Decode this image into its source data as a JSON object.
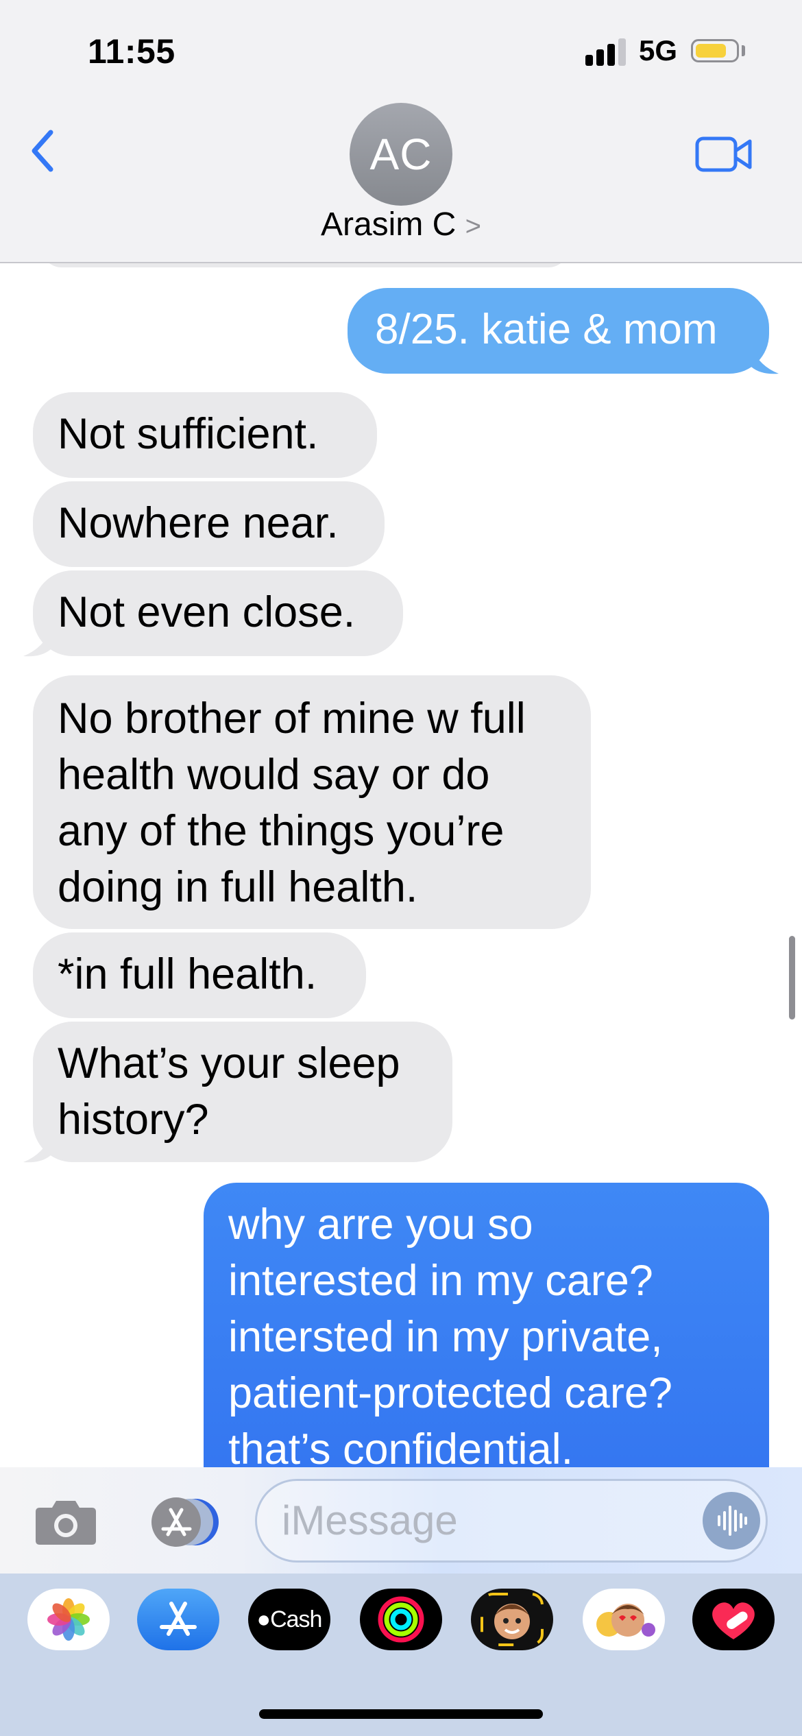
{
  "status_bar": {
    "time": "11:55",
    "network": "5G",
    "battery_level": 0.7,
    "signal_bars": 3
  },
  "header": {
    "avatar_initials": "AC",
    "contact_name": "Arasim C",
    "chevron": ">",
    "back_icon": "chevron-left-icon",
    "video_icon": "video-camera-icon"
  },
  "messages": [
    {
      "direction": "outgoing",
      "text": "8/25. katie & mom"
    },
    {
      "direction": "incoming",
      "text": "Not sufficient."
    },
    {
      "direction": "incoming",
      "text": "Nowhere near."
    },
    {
      "direction": "incoming",
      "text": "Not even close."
    },
    {
      "direction": "incoming",
      "text": "No brother of mine w full\nhealth would say or do\nany of the things you’re\ndoing in full health."
    },
    {
      "direction": "incoming",
      "text": "*in full health."
    },
    {
      "direction": "incoming",
      "text": "What’s your sleep\nhistory?"
    },
    {
      "direction": "outgoing",
      "text": "why arre you so\ninterested in my care?\nintersted in my private,\npatient-protected care?\nthat’s confidential."
    }
  ],
  "composer": {
    "placeholder": "iMessage",
    "camera_icon": "camera-icon",
    "apps_icon": "app-store-icon",
    "audio_icon": "audio-waveform-icon"
  },
  "app_drawer": [
    {
      "name": "Photos",
      "icon": "photos-icon"
    },
    {
      "name": "App Store",
      "icon": "app-store-icon"
    },
    {
      "name": "Cash",
      "label": "Cash",
      "icon": "cash-app-icon"
    },
    {
      "name": "Activity",
      "icon": "activity-rings-icon"
    },
    {
      "name": "Memoji",
      "icon": "memoji-icon"
    },
    {
      "name": "Memoji Stickers",
      "icon": "memoji-stickers-icon"
    },
    {
      "name": "Digital Touch",
      "icon": "heart-icon"
    }
  ],
  "colors": {
    "ios_blue": "#3478f6",
    "incoming_bubble": "#e9e9eb",
    "outgoing_bubble_light": "#64aef4",
    "outgoing_bubble_dark": "#3a82f4"
  }
}
